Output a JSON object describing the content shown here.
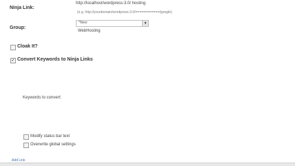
{
  "form": {
    "ninja_link_label": "Ninja Link:",
    "ninja_link_value": "http://localhost/wordpress-3.0/ hosting",
    "ninja_link_example": "(e.g. http://yourdomain/wordpress-3.0/============/google)",
    "group_label": "Group:",
    "group_select_value": "*New:",
    "group_new_value": "WebHosting",
    "cloak_label": "Cloak It?",
    "cloak_checked": false,
    "convert_keywords_label": "Convert Keywords to Ninja Links",
    "convert_keywords_checked": true,
    "keywords_to_convert_label": "Keywords to convert:",
    "modify_status_label": "Modify status bar text",
    "overwrite_global_label": "Overwrite global settings",
    "add_link": "Add Link"
  },
  "icons": {
    "dropdown": "chevron-down-icon",
    "check": "checkmark"
  }
}
